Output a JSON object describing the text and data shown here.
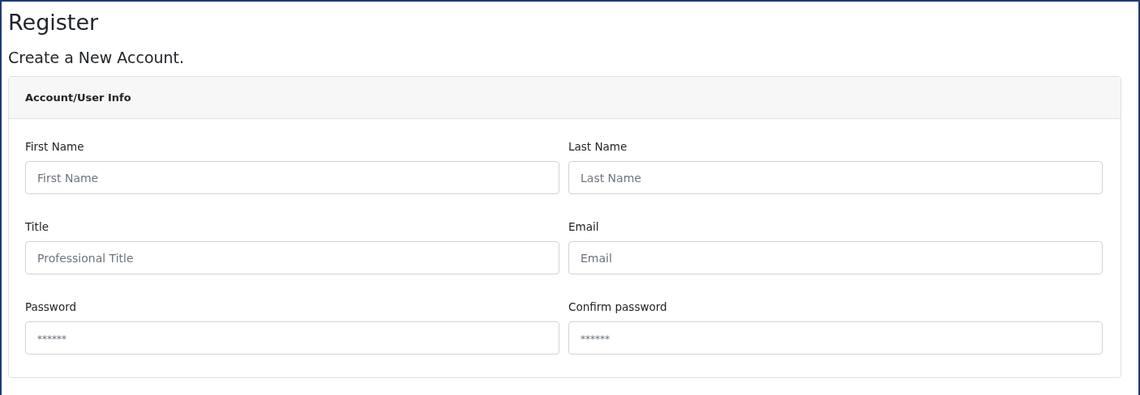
{
  "title": "Register",
  "subtitle": "Create a New Account.",
  "card": {
    "header": "Account/User Info",
    "fields": [
      {
        "label": "First Name",
        "placeholder": "First Name",
        "kind": "text"
      },
      {
        "label": "Last Name",
        "placeholder": "Last Name",
        "kind": "text"
      },
      {
        "label": "Title",
        "placeholder": "Professional Title",
        "kind": "text"
      },
      {
        "label": "Email",
        "placeholder": "Email",
        "kind": "email"
      },
      {
        "label": "Password",
        "placeholder": "******",
        "kind": "password"
      },
      {
        "label": "Confirm password",
        "placeholder": "******",
        "kind": "password"
      }
    ]
  }
}
